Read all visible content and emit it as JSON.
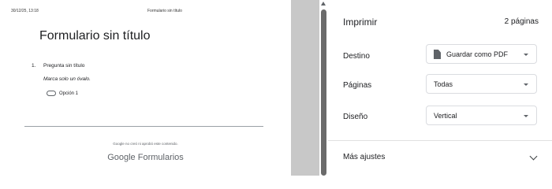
{
  "preview": {
    "header_date": "30/12/25, 13:18",
    "header_title": "Formulario sin título",
    "doc_title": "Formulario sin título",
    "question_number": "1.",
    "question_text": "Pregunta sin título",
    "question_hint": "Marca solo un óvalo.",
    "option_label": "Opción 1",
    "disclaimer": "Google no creó ni aprobó este contenido.",
    "brand_google": "Google",
    "brand_product": "Formularios"
  },
  "panel": {
    "title": "Imprimir",
    "pages_count": "2 páginas",
    "destination_label": "Destino",
    "destination_value": "Guardar como PDF",
    "destination_icon": "document-icon",
    "pages_label": "Páginas",
    "pages_value": "Todas",
    "layout_label": "Diseño",
    "layout_value": "Vertical",
    "more_settings": "Más ajustes"
  }
}
